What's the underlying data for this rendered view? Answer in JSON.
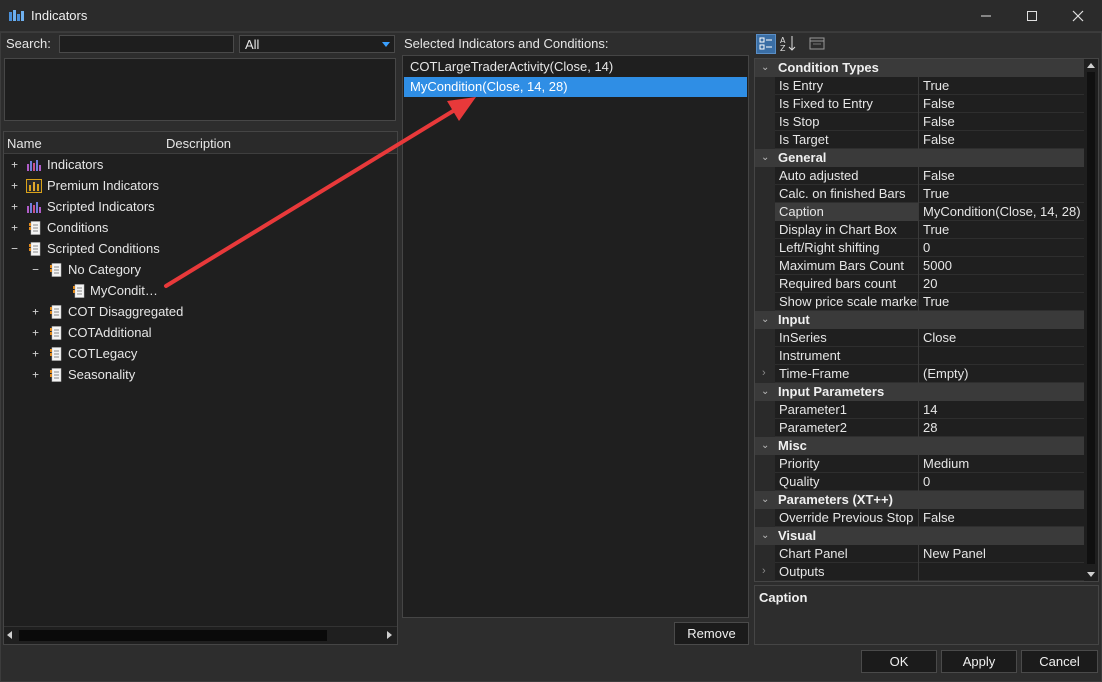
{
  "window": {
    "title": "Indicators",
    "icon": "indicators-app-icon",
    "controls": [
      "minimize-icon",
      "maximize-icon",
      "close-icon"
    ]
  },
  "search": {
    "label": "Search:",
    "value": "",
    "filter_value": "All"
  },
  "tree": {
    "header_name": "Name",
    "header_description": "Description",
    "items": [
      {
        "label": "Indicators",
        "expander": "+",
        "icon": "indicator-chart-icon"
      },
      {
        "label": "Premium Indicators",
        "expander": "+",
        "icon": "premium-chart-icon"
      },
      {
        "label": "Scripted Indicators",
        "expander": "+",
        "icon": "indicator-chart-icon"
      },
      {
        "label": "Conditions",
        "expander": "+",
        "icon": "condition-doc-icon"
      },
      {
        "label": "Scripted Conditions",
        "expander": "−",
        "icon": "condition-doc-icon"
      },
      {
        "label": "No Category",
        "expander": "−",
        "icon": "condition-doc-icon"
      },
      {
        "label": "MyCondit…",
        "expander": "",
        "icon": "condition-doc-icon"
      },
      {
        "label": "COT Disaggregated",
        "expander": "+",
        "icon": "condition-doc-icon"
      },
      {
        "label": "COTAdditional",
        "expander": "+",
        "icon": "condition-doc-icon"
      },
      {
        "label": "COTLegacy",
        "expander": "+",
        "icon": "condition-doc-icon"
      },
      {
        "label": "Seasonality",
        "expander": "+",
        "icon": "condition-doc-icon"
      }
    ]
  },
  "selected": {
    "label": "Selected Indicators and Conditions:",
    "items": [
      {
        "label": "COTLargeTraderActivity(Close, 14)",
        "selected": false
      },
      {
        "label": "MyCondition(Close, 14, 28)",
        "selected": true
      }
    ],
    "remove_label": "Remove"
  },
  "properties": {
    "toolbar": [
      "categorized-view-icon",
      "alphabetical-sort-icon",
      "property-pages-icon"
    ],
    "categories": [
      {
        "name": "Condition Types",
        "rows": [
          {
            "name": "Is Entry",
            "value": "True"
          },
          {
            "name": "Is Fixed to Entry",
            "value": "False"
          },
          {
            "name": "Is Stop",
            "value": "False"
          },
          {
            "name": "Is Target",
            "value": "False"
          }
        ]
      },
      {
        "name": "General",
        "rows": [
          {
            "name": "Auto adjusted",
            "value": "False"
          },
          {
            "name": "Calc. on finished Bars",
            "value": "True"
          },
          {
            "name": "Caption",
            "value": "MyCondition(Close, 14, 28)"
          },
          {
            "name": "Display in Chart Box",
            "value": "True"
          },
          {
            "name": "Left/Right shifting",
            "value": "0"
          },
          {
            "name": "Maximum Bars Count",
            "value": "5000"
          },
          {
            "name": "Required bars count",
            "value": "20"
          },
          {
            "name": "Show price scale marker",
            "value": "True"
          }
        ]
      },
      {
        "name": "Input",
        "rows": [
          {
            "name": "InSeries",
            "value": "Close"
          },
          {
            "name": "Instrument",
            "value": ""
          },
          {
            "name": "Time-Frame",
            "value": "(Empty)"
          }
        ]
      },
      {
        "name": "Input Parameters",
        "rows": [
          {
            "name": "Parameter1",
            "value": "14"
          },
          {
            "name": "Parameter2",
            "value": "28"
          }
        ]
      },
      {
        "name": "Misc",
        "rows": [
          {
            "name": "Priority",
            "value": "Medium"
          },
          {
            "name": "Quality",
            "value": "0"
          }
        ]
      },
      {
        "name": "Parameters (XT++)",
        "rows": [
          {
            "name": "Override Previous Stop",
            "value": "False"
          }
        ]
      },
      {
        "name": "Visual",
        "rows": [
          {
            "name": "Chart Panel",
            "value": "New Panel"
          },
          {
            "name": "Outputs",
            "value": ""
          }
        ]
      }
    ],
    "help_title": "Caption"
  },
  "footer": {
    "ok_label": "OK",
    "apply_label": "Apply",
    "cancel_label": "Cancel"
  },
  "colors": {
    "selection": "#2f8ee5",
    "annotation_arrow": "#e8393a"
  }
}
